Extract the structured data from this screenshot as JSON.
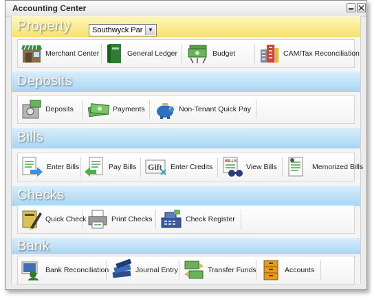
{
  "window": {
    "title": "Accounting Center"
  },
  "sections": {
    "property": {
      "title": "Property",
      "selected_property": "Southwyck Par",
      "items": [
        "Merchant Center",
        "General Ledger",
        "Budget",
        "CAM/Tax Reconciliation"
      ]
    },
    "deposits": {
      "title": "Deposits",
      "items": [
        "Deposits",
        "Payments",
        "Non-Tenant Quick Pay"
      ]
    },
    "bills": {
      "title": "Bills",
      "items": [
        "Enter Bills",
        "Pay Bills",
        "Enter Credits",
        "View Bills",
        "Memorized Bills"
      ]
    },
    "checks": {
      "title": "Checks",
      "items": [
        "Quick Check",
        "Print Checks",
        "Check Register"
      ]
    },
    "bank": {
      "title": "Bank",
      "items": [
        "Bank Reconciliation",
        "Journal Entry",
        "Transfer Funds",
        "Accounts"
      ]
    },
    "icon_labels": {
      "gift": "Gift",
      "bills": "BILLS"
    }
  },
  "colors": {
    "yellow_header": "#f6e372",
    "blue_header": "#a9d5f3"
  }
}
